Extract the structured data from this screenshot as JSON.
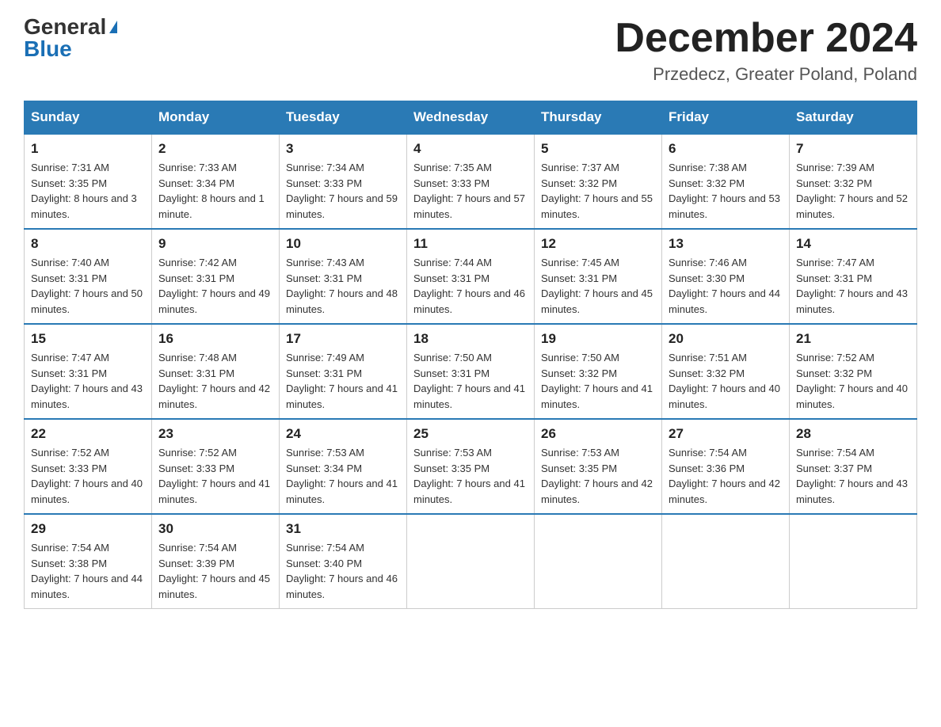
{
  "logo": {
    "general": "General",
    "blue": "Blue"
  },
  "title": "December 2024",
  "location": "Przedecz, Greater Poland, Poland",
  "days_of_week": [
    "Sunday",
    "Monday",
    "Tuesday",
    "Wednesday",
    "Thursday",
    "Friday",
    "Saturday"
  ],
  "weeks": [
    [
      {
        "day": "1",
        "sunrise": "7:31 AM",
        "sunset": "3:35 PM",
        "daylight": "8 hours and 3 minutes."
      },
      {
        "day": "2",
        "sunrise": "7:33 AM",
        "sunset": "3:34 PM",
        "daylight": "8 hours and 1 minute."
      },
      {
        "day": "3",
        "sunrise": "7:34 AM",
        "sunset": "3:33 PM",
        "daylight": "7 hours and 59 minutes."
      },
      {
        "day": "4",
        "sunrise": "7:35 AM",
        "sunset": "3:33 PM",
        "daylight": "7 hours and 57 minutes."
      },
      {
        "day": "5",
        "sunrise": "7:37 AM",
        "sunset": "3:32 PM",
        "daylight": "7 hours and 55 minutes."
      },
      {
        "day": "6",
        "sunrise": "7:38 AM",
        "sunset": "3:32 PM",
        "daylight": "7 hours and 53 minutes."
      },
      {
        "day": "7",
        "sunrise": "7:39 AM",
        "sunset": "3:32 PM",
        "daylight": "7 hours and 52 minutes."
      }
    ],
    [
      {
        "day": "8",
        "sunrise": "7:40 AM",
        "sunset": "3:31 PM",
        "daylight": "7 hours and 50 minutes."
      },
      {
        "day": "9",
        "sunrise": "7:42 AM",
        "sunset": "3:31 PM",
        "daylight": "7 hours and 49 minutes."
      },
      {
        "day": "10",
        "sunrise": "7:43 AM",
        "sunset": "3:31 PM",
        "daylight": "7 hours and 48 minutes."
      },
      {
        "day": "11",
        "sunrise": "7:44 AM",
        "sunset": "3:31 PM",
        "daylight": "7 hours and 46 minutes."
      },
      {
        "day": "12",
        "sunrise": "7:45 AM",
        "sunset": "3:31 PM",
        "daylight": "7 hours and 45 minutes."
      },
      {
        "day": "13",
        "sunrise": "7:46 AM",
        "sunset": "3:30 PM",
        "daylight": "7 hours and 44 minutes."
      },
      {
        "day": "14",
        "sunrise": "7:47 AM",
        "sunset": "3:31 PM",
        "daylight": "7 hours and 43 minutes."
      }
    ],
    [
      {
        "day": "15",
        "sunrise": "7:47 AM",
        "sunset": "3:31 PM",
        "daylight": "7 hours and 43 minutes."
      },
      {
        "day": "16",
        "sunrise": "7:48 AM",
        "sunset": "3:31 PM",
        "daylight": "7 hours and 42 minutes."
      },
      {
        "day": "17",
        "sunrise": "7:49 AM",
        "sunset": "3:31 PM",
        "daylight": "7 hours and 41 minutes."
      },
      {
        "day": "18",
        "sunrise": "7:50 AM",
        "sunset": "3:31 PM",
        "daylight": "7 hours and 41 minutes."
      },
      {
        "day": "19",
        "sunrise": "7:50 AM",
        "sunset": "3:32 PM",
        "daylight": "7 hours and 41 minutes."
      },
      {
        "day": "20",
        "sunrise": "7:51 AM",
        "sunset": "3:32 PM",
        "daylight": "7 hours and 40 minutes."
      },
      {
        "day": "21",
        "sunrise": "7:52 AM",
        "sunset": "3:32 PM",
        "daylight": "7 hours and 40 minutes."
      }
    ],
    [
      {
        "day": "22",
        "sunrise": "7:52 AM",
        "sunset": "3:33 PM",
        "daylight": "7 hours and 40 minutes."
      },
      {
        "day": "23",
        "sunrise": "7:52 AM",
        "sunset": "3:33 PM",
        "daylight": "7 hours and 41 minutes."
      },
      {
        "day": "24",
        "sunrise": "7:53 AM",
        "sunset": "3:34 PM",
        "daylight": "7 hours and 41 minutes."
      },
      {
        "day": "25",
        "sunrise": "7:53 AM",
        "sunset": "3:35 PM",
        "daylight": "7 hours and 41 minutes."
      },
      {
        "day": "26",
        "sunrise": "7:53 AM",
        "sunset": "3:35 PM",
        "daylight": "7 hours and 42 minutes."
      },
      {
        "day": "27",
        "sunrise": "7:54 AM",
        "sunset": "3:36 PM",
        "daylight": "7 hours and 42 minutes."
      },
      {
        "day": "28",
        "sunrise": "7:54 AM",
        "sunset": "3:37 PM",
        "daylight": "7 hours and 43 minutes."
      }
    ],
    [
      {
        "day": "29",
        "sunrise": "7:54 AM",
        "sunset": "3:38 PM",
        "daylight": "7 hours and 44 minutes."
      },
      {
        "day": "30",
        "sunrise": "7:54 AM",
        "sunset": "3:39 PM",
        "daylight": "7 hours and 45 minutes."
      },
      {
        "day": "31",
        "sunrise": "7:54 AM",
        "sunset": "3:40 PM",
        "daylight": "7 hours and 46 minutes."
      },
      null,
      null,
      null,
      null
    ]
  ]
}
